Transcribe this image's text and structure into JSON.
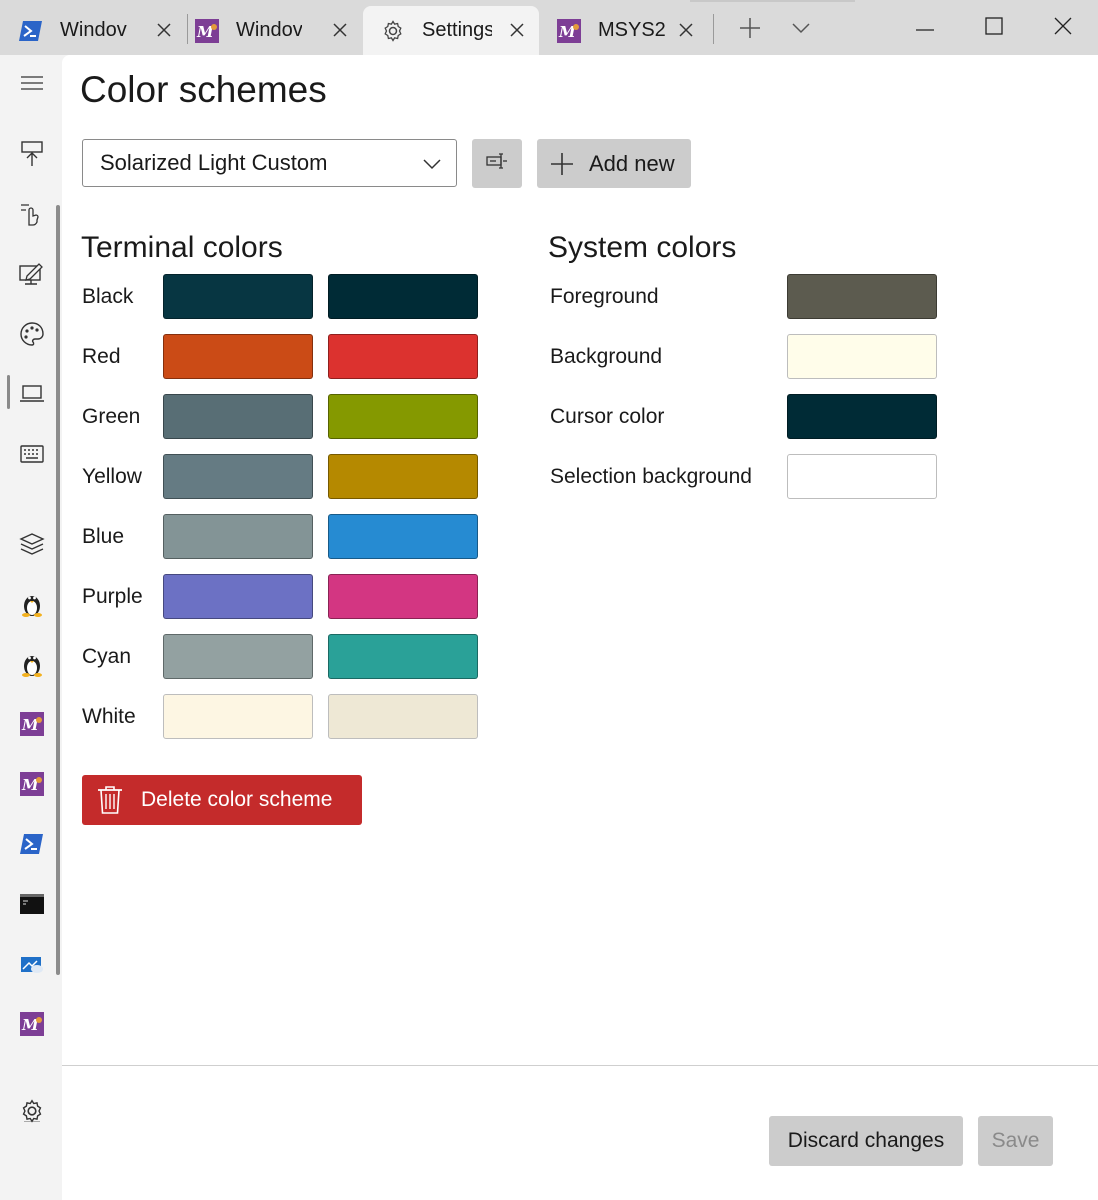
{
  "tabs": [
    {
      "label": "Windov",
      "icon": "powershell-icon"
    },
    {
      "label": "Windov",
      "icon": "msys2-icon"
    },
    {
      "label": "Settings",
      "icon": "gear-icon",
      "active": true
    },
    {
      "label": "MSYS2",
      "icon": "msys2-icon"
    }
  ],
  "titlebar": {
    "new_tab_icon": "plus-icon",
    "dropdown_icon": "chevron-down-icon",
    "minimize_icon": "minimize-icon",
    "maximize_icon": "maximize-icon",
    "close_icon": "close-icon"
  },
  "rail": {
    "items": [
      {
        "name": "hamburger-menu-icon"
      },
      {
        "name": "startup-icon"
      },
      {
        "name": "interaction-icon"
      },
      {
        "name": "appearance-icon"
      },
      {
        "name": "color-schemes-icon",
        "active": true
      },
      {
        "name": "rendering-icon"
      },
      {
        "name": "actions-icon"
      },
      {
        "name": "defaults-icon"
      },
      {
        "name": "linux-icon"
      },
      {
        "name": "linux-icon"
      },
      {
        "name": "msys2-icon"
      },
      {
        "name": "msys2-icon"
      },
      {
        "name": "powershell-icon"
      },
      {
        "name": "command-prompt-icon"
      },
      {
        "name": "azure-cloud-shell-icon"
      },
      {
        "name": "msys2-icon"
      },
      {
        "name": "settings-gear-icon"
      }
    ]
  },
  "page": {
    "title": "Color schemes",
    "selected_scheme": "Solarized Light Custom",
    "add_new_label": "Add new",
    "delete_label": "Delete color scheme"
  },
  "terminal_colors": {
    "title": "Terminal colors",
    "rows": [
      {
        "label": "Black",
        "normal": "#073642",
        "bright": "#002b36"
      },
      {
        "label": "Red",
        "normal": "#cb4b16",
        "bright": "#dc322f"
      },
      {
        "label": "Green",
        "normal": "#586e75",
        "bright": "#859900"
      },
      {
        "label": "Yellow",
        "normal": "#657b83",
        "bright": "#b58900"
      },
      {
        "label": "Blue",
        "normal": "#839496",
        "bright": "#268bd2"
      },
      {
        "label": "Purple",
        "normal": "#6c71c4",
        "bright": "#d33682"
      },
      {
        "label": "Cyan",
        "normal": "#93a1a1",
        "bright": "#2aa198"
      },
      {
        "label": "White",
        "normal": "#fdf6e3",
        "bright": "#eee8d5"
      }
    ]
  },
  "system_colors": {
    "title": "System colors",
    "rows": [
      {
        "label": "Foreground",
        "color": "#5c5b4f"
      },
      {
        "label": "Background",
        "color": "#fffdea"
      },
      {
        "label": "Cursor color",
        "color": "#002b36"
      },
      {
        "label": "Selection background",
        "color": "#ffffff"
      }
    ]
  },
  "footer": {
    "discard_label": "Discard changes",
    "save_label": "Save"
  }
}
